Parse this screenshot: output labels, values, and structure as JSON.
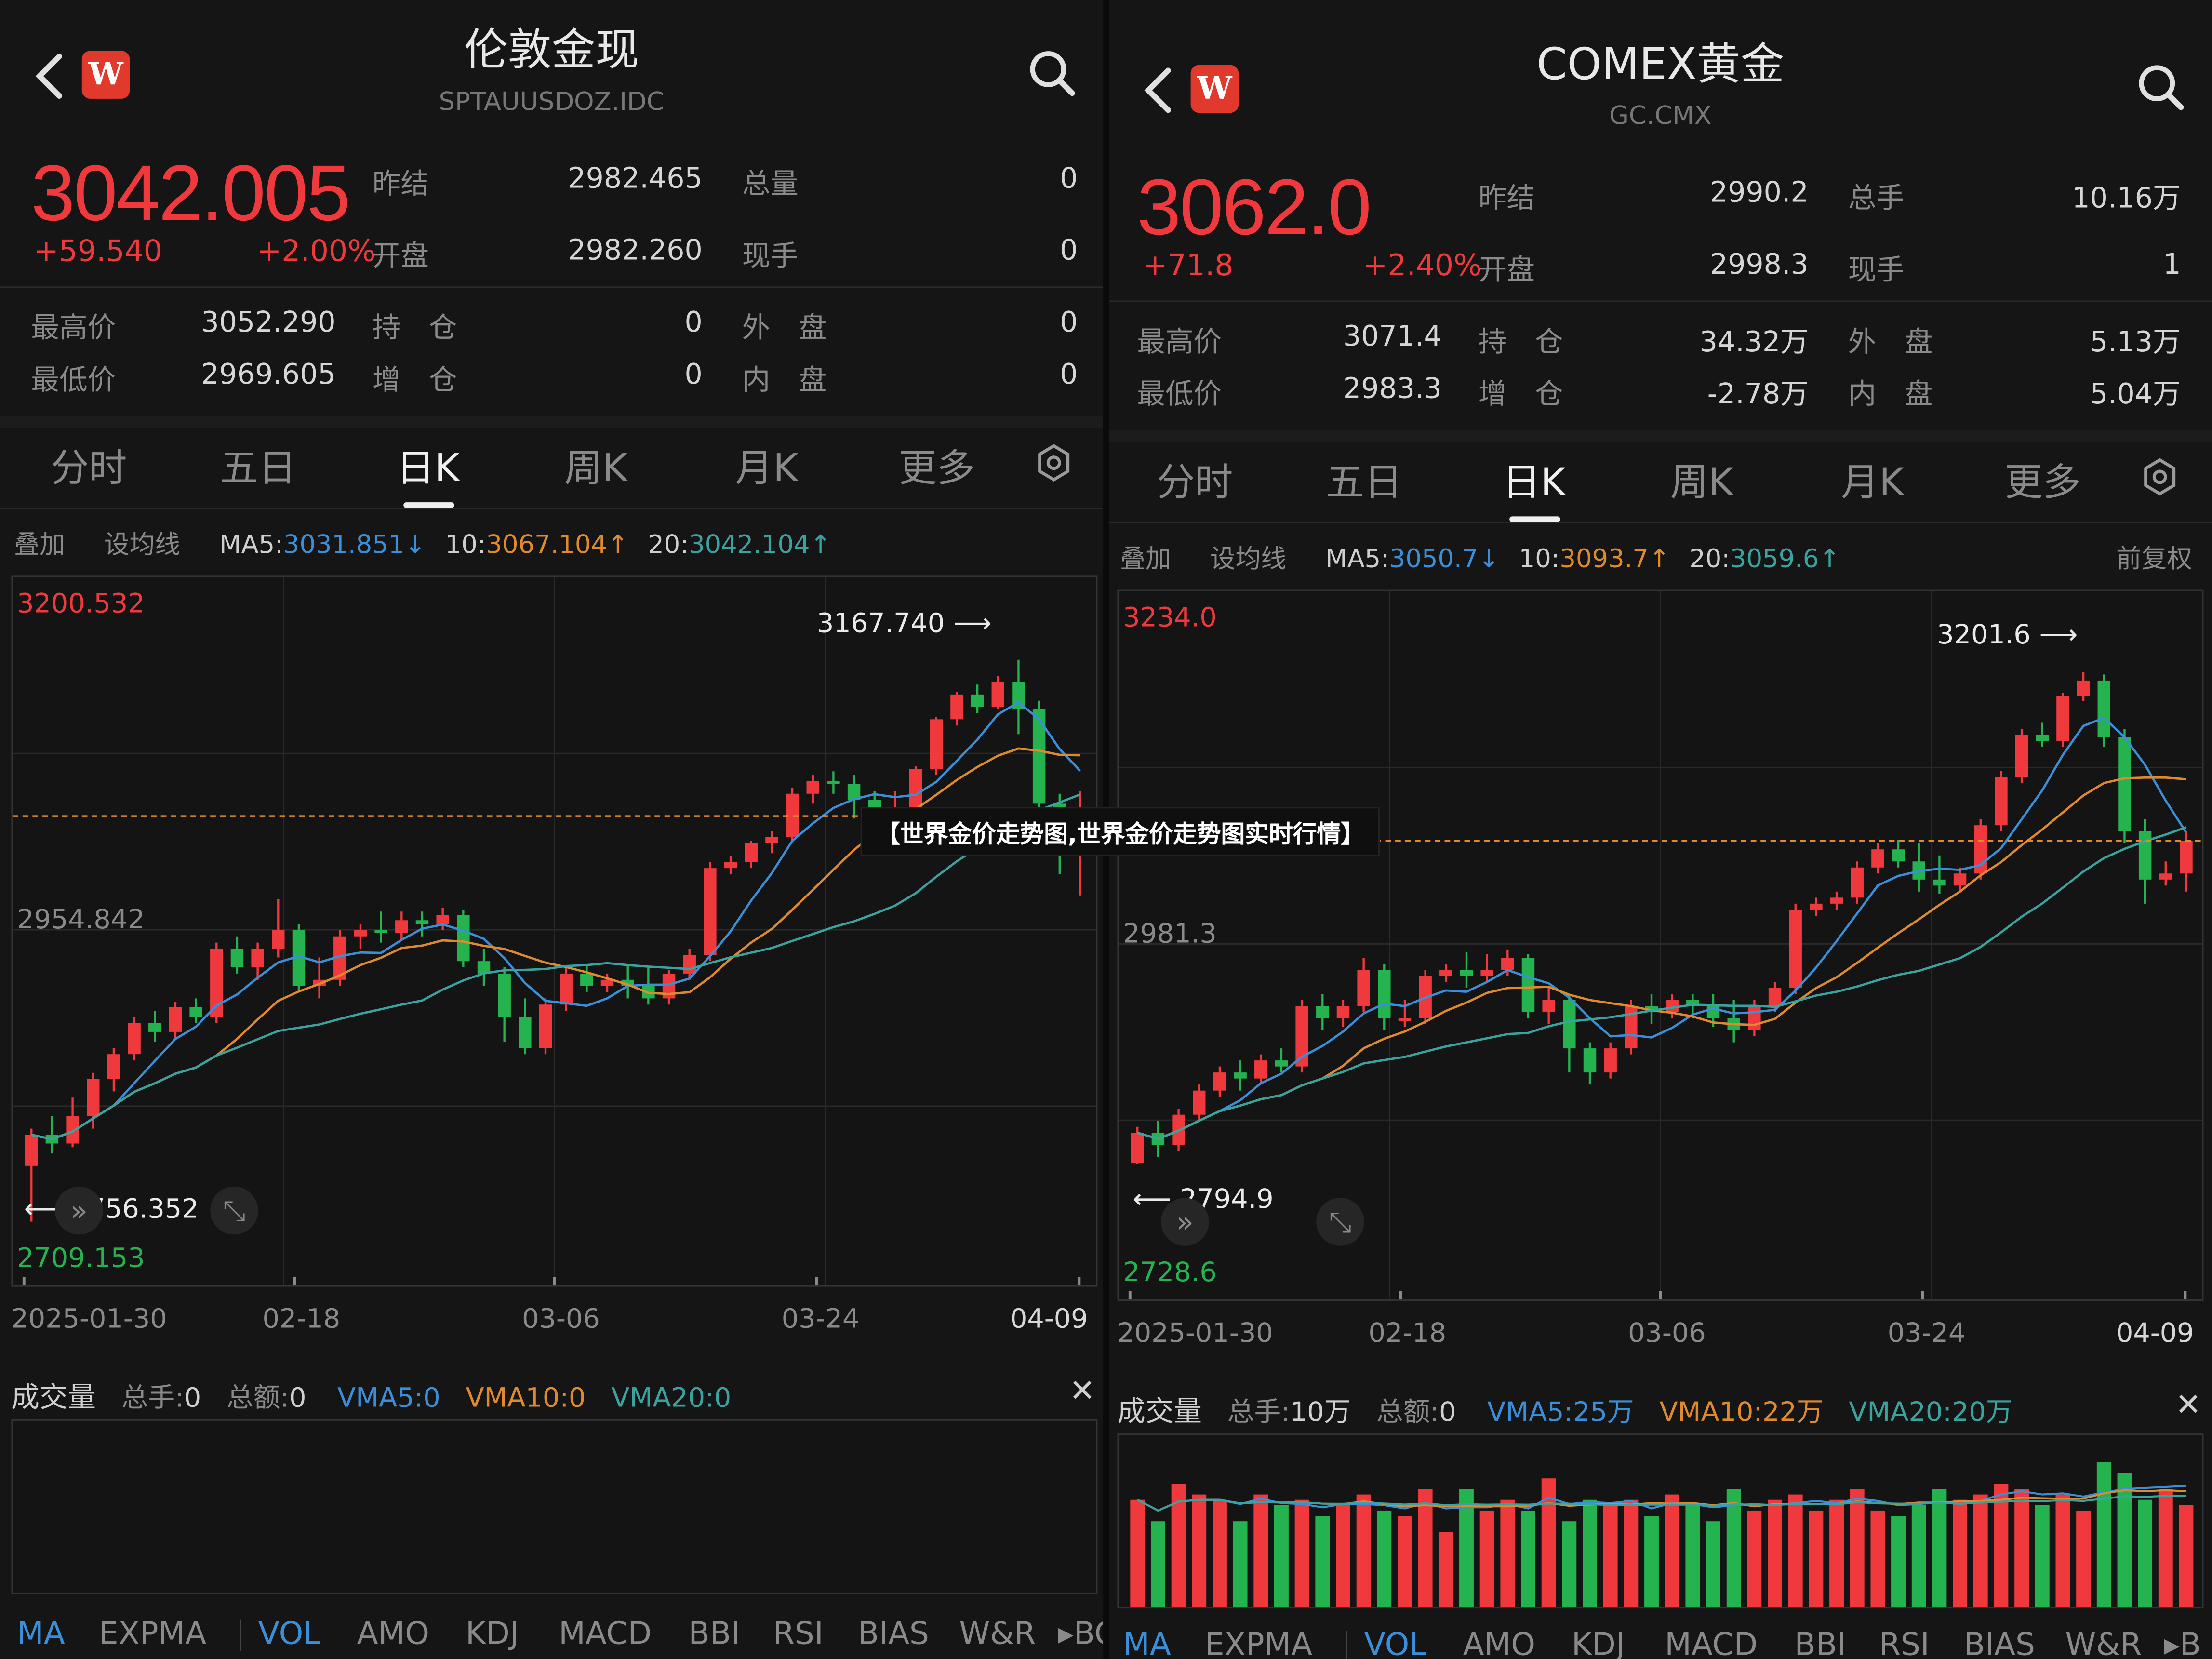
{
  "overlay_caption": "【世界金价走势图,世界金价走势图实时行情】",
  "colors": {
    "up": "#f0393c",
    "down": "#25b350",
    "ma5": "#3b8fd9",
    "ma10": "#e08a2e",
    "ma20": "#3aa3a0",
    "bg": "#141414"
  },
  "panels": [
    {
      "title": "伦敦金现",
      "code": "SPTAUUSDOZ.IDC",
      "logo": "W",
      "price": "3042.005",
      "change": "+59.540",
      "change_pct": "+2.00%",
      "stats": {
        "prev_close_label": "昨结",
        "prev_close": "2982.465",
        "volume_label": "总量",
        "volume": "0",
        "open_label": "开盘",
        "open": "2982.260",
        "cur_label": "现手",
        "cur": "0",
        "high_label": "最高价",
        "high": "3052.290",
        "oi_label": "持　仓",
        "oi": "0",
        "outer_label": "外　盘",
        "outer": "0",
        "low_label": "最低价",
        "low": "2969.605",
        "add_label": "增　仓",
        "add": "0",
        "inner_label": "内　盘",
        "inner": "0"
      },
      "tabs": [
        "分时",
        "五日",
        "日K",
        "周K",
        "月K",
        "更多"
      ],
      "active_tab": "日K",
      "ma_bar": {
        "overlay": "叠加",
        "set": "设均线",
        "ma5_label": "MA5:",
        "ma5": "3031.851↓",
        "ma10_label": "10:",
        "ma10": "3067.104↑",
        "ma20_label": "20:",
        "ma20": "3042.104↑",
        "adj": ""
      },
      "y_top": "3200.532",
      "y_mid": "2954.842",
      "y_bottom": "2709.153",
      "high_marker": "3167.740 ⟶",
      "low_marker": "⟵ 2756.352",
      "dates": [
        "2025-01-30",
        "02-18",
        "03-06",
        "03-24",
        "04-09"
      ],
      "vol_bar": {
        "title": "成交量",
        "total_hand_label": "总手:",
        "total_hand": "0",
        "total_amt_label": "总额:",
        "total_amt": "0",
        "vma5": "VMA5:0",
        "vma10": "VMA10:0",
        "vma20": "VMA20:0"
      },
      "indicators": [
        "MA",
        "EXPMA",
        "VOL",
        "AMO",
        "KDJ",
        "MACD",
        "BBI",
        "RSI",
        "BIAS",
        "W&R",
        "▸BO"
      ],
      "chart_data": {
        "type": "candlestick",
        "ylim": [
          2709.153,
          3200.532
        ],
        "candles": [
          [
            2760,
            2785,
            2715,
            2790
          ],
          [
            2785,
            2778,
            2770,
            2800
          ],
          [
            2778,
            2800,
            2775,
            2815
          ],
          [
            2800,
            2830,
            2790,
            2835
          ],
          [
            2830,
            2850,
            2820,
            2855
          ],
          [
            2850,
            2875,
            2845,
            2880
          ],
          [
            2875,
            2868,
            2860,
            2885
          ],
          [
            2868,
            2888,
            2862,
            2892
          ],
          [
            2888,
            2880,
            2875,
            2895
          ],
          [
            2880,
            2935,
            2875,
            2940
          ],
          [
            2935,
            2920,
            2915,
            2945
          ],
          [
            2920,
            2935,
            2910,
            2940
          ],
          [
            2935,
            2950,
            2928,
            2975
          ],
          [
            2950,
            2905,
            2900,
            2955
          ],
          [
            2905,
            2910,
            2895,
            2928
          ],
          [
            2910,
            2945,
            2905,
            2950
          ],
          [
            2945,
            2950,
            2935,
            2955
          ],
          [
            2950,
            2948,
            2940,
            2965
          ],
          [
            2948,
            2958,
            2942,
            2965
          ],
          [
            2958,
            2955,
            2945,
            2965
          ],
          [
            2955,
            2962,
            2950,
            2968
          ],
          [
            2962,
            2925,
            2920,
            2966
          ],
          [
            2925,
            2915,
            2905,
            2935
          ],
          [
            2915,
            2880,
            2860,
            2920
          ],
          [
            2880,
            2855,
            2850,
            2895
          ],
          [
            2855,
            2890,
            2850,
            2895
          ],
          [
            2890,
            2915,
            2885,
            2920
          ],
          [
            2915,
            2905,
            2900,
            2922
          ],
          [
            2905,
            2910,
            2900,
            2915
          ],
          [
            2910,
            2905,
            2895,
            2922
          ],
          [
            2905,
            2895,
            2890,
            2920
          ],
          [
            2895,
            2915,
            2890,
            2918
          ],
          [
            2915,
            2930,
            2910,
            2935
          ],
          [
            2930,
            3000,
            2925,
            3005
          ],
          [
            3000,
            3005,
            2995,
            3010
          ],
          [
            3005,
            3020,
            3000,
            3022
          ],
          [
            3020,
            3025,
            3012,
            3030
          ],
          [
            3025,
            3060,
            3022,
            3065
          ],
          [
            3060,
            3070,
            3052,
            3075
          ],
          [
            3070,
            3068,
            3060,
            3078
          ],
          [
            3068,
            3055,
            3040,
            3075
          ],
          [
            3055,
            3045,
            3040,
            3062
          ],
          [
            3045,
            3048,
            3038,
            3062
          ],
          [
            3048,
            3080,
            3045,
            3082
          ],
          [
            3080,
            3120,
            3075,
            3122
          ],
          [
            3120,
            3140,
            3115,
            3142
          ],
          [
            3140,
            3130,
            3125,
            3148
          ],
          [
            3130,
            3150,
            3128,
            3155
          ],
          [
            3150,
            3128,
            3108,
            3168
          ],
          [
            3128,
            3052,
            3045,
            3135
          ],
          [
            3052,
            3020,
            2995,
            3060
          ],
          [
            3020,
            3042,
            2978,
            3062
          ]
        ]
      }
    },
    {
      "title": "COMEX黄金",
      "code": "GC.CMX",
      "logo": "W",
      "price": "3062.0",
      "change": "+71.8",
      "change_pct": "+2.40%",
      "stats": {
        "prev_close_label": "昨结",
        "prev_close": "2990.2",
        "volume_label": "总手",
        "volume": "10.16万",
        "open_label": "开盘",
        "open": "2998.3",
        "cur_label": "现手",
        "cur": "1",
        "high_label": "最高价",
        "high": "3071.4",
        "oi_label": "持　仓",
        "oi": "34.32万",
        "outer_label": "外　盘",
        "outer": "5.13万",
        "low_label": "最低价",
        "low": "2983.3",
        "add_label": "增　仓",
        "add": "-2.78万",
        "inner_label": "内　盘",
        "inner": "5.04万"
      },
      "tabs": [
        "分时",
        "五日",
        "日K",
        "周K",
        "月K",
        "更多"
      ],
      "active_tab": "日K",
      "ma_bar": {
        "overlay": "叠加",
        "set": "设均线",
        "ma5_label": "MA5:",
        "ma5": "3050.7↓",
        "ma10_label": "10:",
        "ma10": "3093.7↑",
        "ma20_label": "20:",
        "ma20": "3059.6↑",
        "adj": "前复权"
      },
      "y_top": "3234.0",
      "y_mid": "2981.3",
      "y_bottom": "2728.6",
      "high_marker": "3201.6 ⟶",
      "low_marker": "⟵ 2794.9",
      "dates": [
        "2025-01-30",
        "02-18",
        "03-06",
        "03-24",
        "04-09"
      ],
      "vol_bar": {
        "title": "成交量",
        "total_hand_label": "总手:",
        "total_hand": "10万",
        "total_amt_label": "总额:",
        "total_amt": "0",
        "vma5": "VMA5:25万",
        "vma10": "VMA10:22万",
        "vma20": "VMA20:20万"
      },
      "indicators": [
        "MA",
        "EXPMA",
        "VOL",
        "AMO",
        "KDJ",
        "MACD",
        "BBI",
        "RSI",
        "BIAS",
        "W&R",
        "▸B"
      ],
      "chart_data": {
        "type": "candlestick",
        "ylim": [
          2728.6,
          3234.0
        ],
        "candles": [
          [
            2795,
            2820,
            2794,
            2825
          ],
          [
            2820,
            2810,
            2800,
            2830
          ],
          [
            2810,
            2835,
            2805,
            2840
          ],
          [
            2835,
            2855,
            2830,
            2860
          ],
          [
            2855,
            2870,
            2850,
            2875
          ],
          [
            2870,
            2865,
            2855,
            2880
          ],
          [
            2865,
            2880,
            2860,
            2885
          ],
          [
            2880,
            2875,
            2870,
            2890
          ],
          [
            2875,
            2925,
            2870,
            2930
          ],
          [
            2925,
            2915,
            2905,
            2935
          ],
          [
            2915,
            2925,
            2908,
            2930
          ],
          [
            2925,
            2955,
            2920,
            2965
          ],
          [
            2955,
            2915,
            2905,
            2960
          ],
          [
            2915,
            2915,
            2908,
            2930
          ],
          [
            2915,
            2950,
            2910,
            2955
          ],
          [
            2950,
            2955,
            2945,
            2960
          ],
          [
            2955,
            2950,
            2940,
            2970
          ],
          [
            2950,
            2955,
            2945,
            2968
          ],
          [
            2955,
            2965,
            2950,
            2972
          ],
          [
            2965,
            2920,
            2915,
            2968
          ],
          [
            2920,
            2930,
            2910,
            2940
          ],
          [
            2930,
            2890,
            2870,
            2935
          ],
          [
            2890,
            2870,
            2860,
            2895
          ],
          [
            2870,
            2890,
            2865,
            2895
          ],
          [
            2890,
            2925,
            2885,
            2930
          ],
          [
            2925,
            2920,
            2910,
            2935
          ],
          [
            2920,
            2930,
            2915,
            2935
          ],
          [
            2930,
            2925,
            2915,
            2935
          ],
          [
            2925,
            2915,
            2908,
            2935
          ],
          [
            2915,
            2905,
            2895,
            2930
          ],
          [
            2905,
            2925,
            2900,
            2930
          ],
          [
            2925,
            2940,
            2920,
            2945
          ],
          [
            2940,
            3005,
            2935,
            3010
          ],
          [
            3005,
            3010,
            3000,
            3015
          ],
          [
            3010,
            3015,
            3005,
            3020
          ],
          [
            3015,
            3040,
            3010,
            3045
          ],
          [
            3040,
            3055,
            3035,
            3060
          ],
          [
            3055,
            3045,
            3040,
            3063
          ],
          [
            3045,
            3030,
            3020,
            3060
          ],
          [
            3030,
            3025,
            3018,
            3050
          ],
          [
            3025,
            3035,
            3020,
            3040
          ],
          [
            3035,
            3075,
            3030,
            3080
          ],
          [
            3075,
            3115,
            3070,
            3120
          ],
          [
            3115,
            3150,
            3110,
            3155
          ],
          [
            3150,
            3145,
            3140,
            3160
          ],
          [
            3145,
            3182,
            3140,
            3185
          ],
          [
            3182,
            3195,
            3178,
            3202
          ],
          [
            3195,
            3148,
            3140,
            3200
          ],
          [
            3148,
            3070,
            3060,
            3155
          ],
          [
            3070,
            3030,
            3010,
            3080
          ],
          [
            3030,
            3035,
            3025,
            3045
          ],
          [
            3035,
            3062,
            3020,
            3070
          ]
        ],
        "volumes": [
          20,
          16,
          23,
          21,
          20,
          16,
          21,
          19,
          20,
          17,
          19,
          21,
          18,
          17,
          22,
          14,
          22,
          18,
          20,
          18,
          24,
          16,
          20,
          19,
          20,
          17,
          21,
          19,
          16,
          22,
          18,
          20,
          21,
          18,
          20,
          22,
          18,
          17,
          19,
          22,
          20,
          21,
          23,
          22,
          19,
          21,
          18,
          27,
          25,
          20,
          22,
          19
        ]
      }
    }
  ]
}
